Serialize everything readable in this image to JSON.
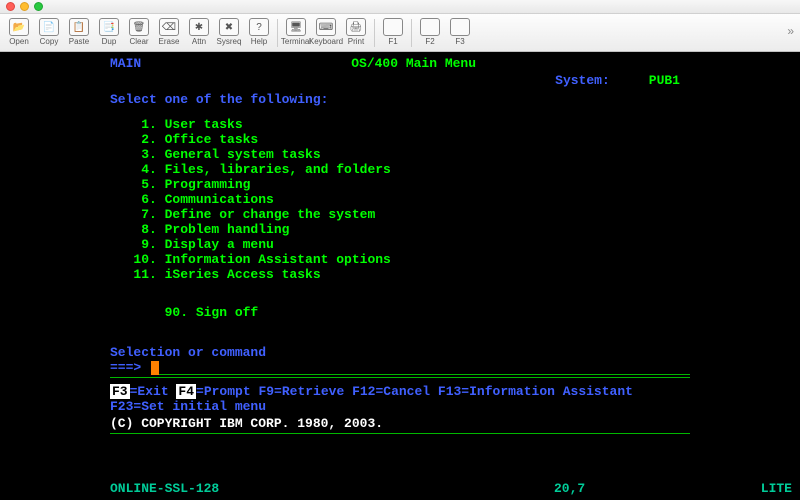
{
  "toolbar": {
    "buttons": [
      "Open",
      "Copy",
      "Paste",
      "Dup",
      "Clear",
      "Erase",
      "Attn",
      "Sysreq",
      "Help",
      "Terminal",
      "Keyboard",
      "Print",
      "F1",
      "F2",
      "F3"
    ],
    "glyphs": [
      "📂",
      "📄",
      "📋",
      "📑",
      "🗑",
      "⌫",
      "✱",
      "✖",
      "?",
      "🖥",
      "⌨",
      "🖨",
      "",
      "",
      ""
    ]
  },
  "screen": {
    "code": "MAIN",
    "title": "OS/400 Main Menu",
    "systemLabel": "System:",
    "systemValue": "PUB1",
    "prompt": "Select one of the following:",
    "items": [
      {
        "n": "1",
        "t": "User tasks"
      },
      {
        "n": "2",
        "t": "Office tasks"
      },
      {
        "n": "3",
        "t": "General system tasks"
      },
      {
        "n": "4",
        "t": "Files, libraries, and folders"
      },
      {
        "n": "5",
        "t": "Programming"
      },
      {
        "n": "6",
        "t": "Communications"
      },
      {
        "n": "7",
        "t": "Define or change the system"
      },
      {
        "n": "8",
        "t": "Problem handling"
      },
      {
        "n": "9",
        "t": "Display a menu"
      },
      {
        "n": "10",
        "t": "Information Assistant options"
      },
      {
        "n": "11",
        "t": "iSeries Access tasks"
      }
    ],
    "signoff": {
      "n": "90",
      "t": "Sign off"
    },
    "cmdLabel": "Selection or command",
    "cmdArrow": "===>",
    "fkeys1": [
      {
        "k": "F3",
        "t": "Exit"
      },
      {
        "k": "F4",
        "t": "Prompt"
      },
      {
        "k": "F9",
        "t": "Retrieve"
      },
      {
        "k": "F12",
        "t": "Cancel"
      },
      {
        "k": "F13",
        "t": "Information Assistant"
      }
    ],
    "fkeys2": [
      {
        "k": "F23",
        "t": "Set initial menu"
      }
    ],
    "copyright": "(C) COPYRIGHT IBM CORP. 1980, 2003."
  },
  "status": {
    "conn": "ONLINE-SSL-128",
    "pos": "20,7",
    "mode": "LITE"
  }
}
